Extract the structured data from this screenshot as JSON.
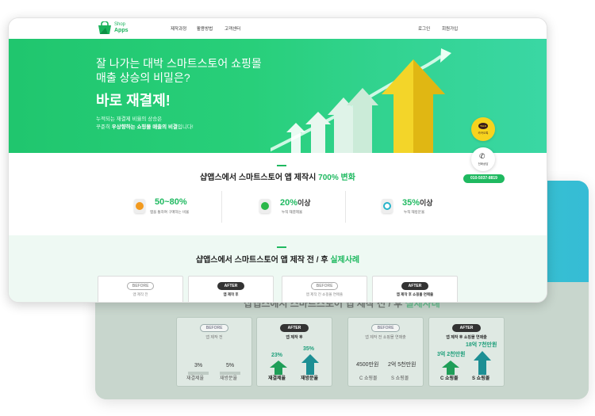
{
  "nav": {
    "logo_top": "Shop",
    "logo_bottom": "Apps",
    "menu": [
      "제작과정",
      "활용방법",
      "고객센터"
    ],
    "auth": [
      "로그인",
      "회원가입"
    ]
  },
  "hero": {
    "title_line1": "잘 나가는 대박 스마트스토어 쇼핑몰",
    "title_line2": "매출 상승의 비밀은?",
    "strong": "바로 재결제!",
    "desc_line1": "누적되는 재결제 비율의 상승은",
    "desc_pre": "꾸준히 ",
    "desc_bold": "우상향하는 쇼핑몰 매출의 비결",
    "desc_post": "입니다!"
  },
  "floating": {
    "kakao_badge": "TALK",
    "kakao_label": "카카오톡",
    "call_label": "전화상담",
    "phone": "010-5037-8819"
  },
  "section1": {
    "title_pre": "샵앱스에서 스마트스토어 앱 제작시 ",
    "title_hl": "700% 변화",
    "stats": [
      {
        "value": "50~80%",
        "caption": "앱을 통하여 구매하는 비율",
        "icon": "coin-icon",
        "color": "#f29a1f"
      },
      {
        "value": "20%",
        "suffix": "이상",
        "caption": "누적 재결제율",
        "icon": "target-icon",
        "color": "#2bb84a"
      },
      {
        "value": "35%",
        "suffix": "이상",
        "caption": "누적 재방문율",
        "icon": "refresh-icon",
        "color": "#27b3c9"
      }
    ]
  },
  "section2": {
    "title_pre": "샵앱스에서 스마트스토어 앱 제작 전 / 후 ",
    "title_hl": "실제사례",
    "cards": [
      {
        "badge": "BEFORE",
        "sub": "앱 제작 전",
        "dark": false
      },
      {
        "badge": "AFTER",
        "sub": "앱 제작 후",
        "dark": true
      },
      {
        "badge": "BEFORE",
        "sub": "앱 제작 전 쇼핑몰 연매출",
        "dark": false
      },
      {
        "badge": "AFTER",
        "sub": "앱 제작 후 쇼핑몰 연매출",
        "dark": true
      }
    ]
  },
  "back": {
    "title_pre": "샵앱스에서 스마트스토어 앱 제작 전 / 후 ",
    "title_hl": "실제사례",
    "cards": [
      {
        "badge": "BEFORE",
        "sub": "앱 제작 전",
        "v1": "3%",
        "v2": "5%",
        "l1": "재결제율",
        "l2": "재방문율"
      },
      {
        "badge": "AFTER",
        "sub": "앱 제작 후",
        "v1": "23%",
        "v2": "35%",
        "l1": "재결제율",
        "l2": "재방문율"
      },
      {
        "badge": "BEFORE",
        "sub": "앱 제작 전 쇼핑몰 연매출",
        "v1": "4500만원",
        "v2": "2억 5천만원",
        "l1": "C 쇼핑몰",
        "l2": "S 쇼핑몰"
      },
      {
        "badge": "AFTER",
        "sub": "앱 제작 후 쇼핑몰 연매출",
        "v1": "3억 2천만원",
        "v2": "18억 7천만원",
        "l1": "C 쇼핑몰",
        "l2": "S 쇼핑몰"
      }
    ]
  }
}
